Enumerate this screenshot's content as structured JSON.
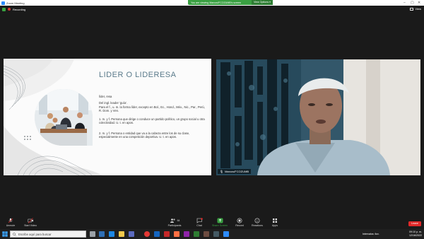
{
  "window": {
    "title": "Zoom Meeting"
  },
  "view_banner": {
    "text": "You are viewing Marcos/FCOZUMB's screen",
    "options_label": "View Options ▾"
  },
  "recording": {
    "label": "Recording"
  },
  "view_button": {
    "label": "View"
  },
  "slide": {
    "title": "LIDER O LIDERESA",
    "lines": [
      "líder, resa",
      "Del ingl. leader 'guía'.",
      "Para el f., u. m. la forma líder, excepto en Bol., Ec., Hond., Méx., Nic., Par., Perú, R. Dom. y Ven.",
      "1. m. y f. Persona que dirige o conduce un partido político, un grupo social u otra colectividad. U. t. en apos.",
      "2. m. y f. Persona o entidad que va a la cabeza entre los de su clase, especialmente en una competición deportiva. U. t. en apos."
    ]
  },
  "video": {
    "participant_name": "Marcos/FCOZUMB"
  },
  "toolbar": {
    "unmute": "Unmute",
    "start_video": "Start Video",
    "participants": "Participants",
    "participants_count": "64",
    "chat": "Chat",
    "share_screen": "Share Screen",
    "record": "Record",
    "reactions": "Reactions",
    "apps": "Apps",
    "leave": "Leave"
  },
  "taskbar": {
    "search_placeholder": "Escribe aquí para buscar",
    "tray_status": "Intervalos: llov.",
    "time": "09:10 p. m.",
    "date": "12/16/2022"
  },
  "colors": {
    "accent_green": "#3aa042",
    "leave_red": "#e02828",
    "zoom_blue": "#2d8cff"
  }
}
